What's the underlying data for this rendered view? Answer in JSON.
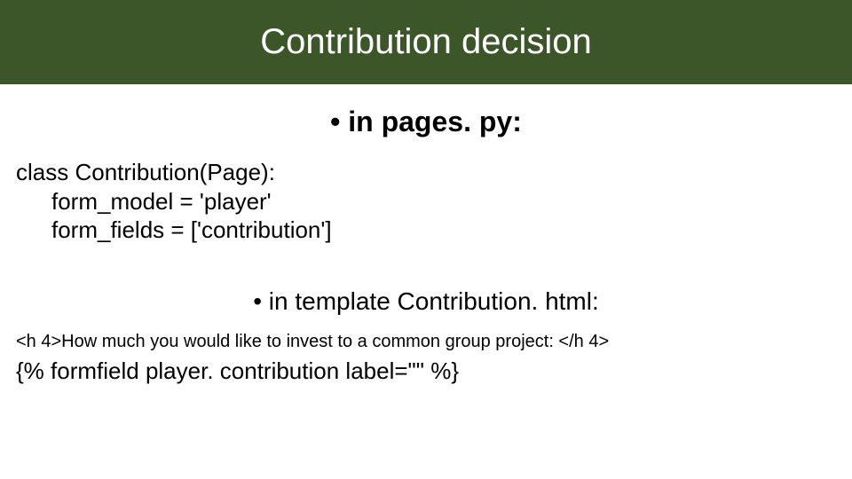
{
  "title": "Contribution decision",
  "bullet1": "• in pages. py:",
  "code_py": {
    "line1": "class Contribution(Page):",
    "line2": "form_model = 'player'",
    "line3": "form_fields = ['contribution']"
  },
  "bullet2": "• in template Contribution. html:",
  "h4_line": "<h 4>How much you would like to invest to a common group project: </h 4>",
  "template_line": "{% formfield player. contribution label=\"\" %}"
}
